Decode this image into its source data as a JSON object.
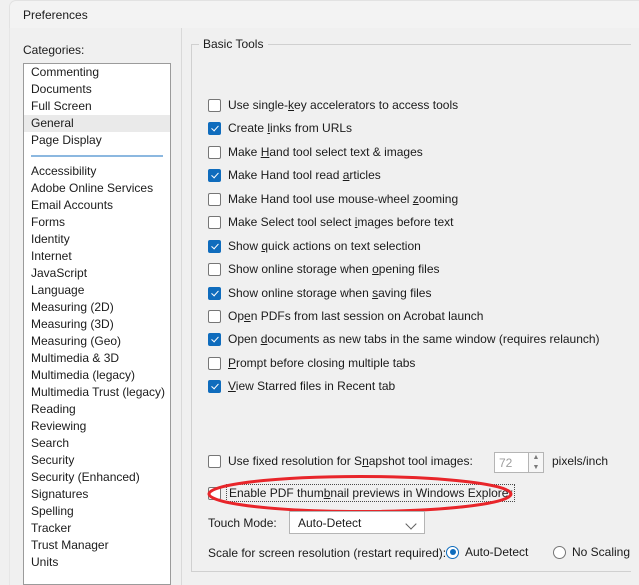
{
  "window": {
    "title": "Preferences"
  },
  "categories": {
    "label": "Categories:",
    "selected": "General",
    "group_top": [
      "Commenting",
      "Documents",
      "Full Screen",
      "General",
      "Page Display"
    ],
    "group_bottom": [
      "Accessibility",
      "Adobe Online Services",
      "Email Accounts",
      "Forms",
      "Identity",
      "Internet",
      "JavaScript",
      "Language",
      "Measuring (2D)",
      "Measuring (3D)",
      "Measuring (Geo)",
      "Multimedia & 3D",
      "Multimedia (legacy)",
      "Multimedia Trust (legacy)",
      "Reading",
      "Reviewing",
      "Search",
      "Security",
      "Security (Enhanced)",
      "Signatures",
      "Spelling",
      "Tracker",
      "Trust Manager",
      "Units"
    ]
  },
  "basic_tools": {
    "title": "Basic Tools",
    "checkboxes": [
      {
        "label": "Use single-key accelerators to access tools",
        "pre": "Use single-",
        "accel": "k",
        "post": "ey accelerators to access tools",
        "checked": false
      },
      {
        "label": "Create links from URLs",
        "pre": "Create ",
        "accel": "l",
        "post": "inks from URLs",
        "checked": true
      },
      {
        "label": "Make Hand tool select text & images",
        "pre": "Make ",
        "accel": "H",
        "post": "and tool select text & images",
        "checked": false
      },
      {
        "label": "Make Hand tool read articles",
        "pre": "Make Hand tool read ",
        "accel": "a",
        "post": "rticles",
        "checked": true
      },
      {
        "label": "Make Hand tool use mouse-wheel zooming",
        "pre": "Make Hand tool use mouse-wheel ",
        "accel": "z",
        "post": "ooming",
        "checked": false
      },
      {
        "label": "Make Select tool select images before text",
        "pre": "Make Select tool select ",
        "accel": "i",
        "post": "mages before text",
        "checked": false
      },
      {
        "label": "Show quick actions on text selection",
        "pre": "Show ",
        "accel": "q",
        "post": "uick actions on text selection",
        "checked": true
      },
      {
        "label": "Show online storage when opening files",
        "pre": "Show online storage when ",
        "accel": "o",
        "post": "pening files",
        "checked": false
      },
      {
        "label": "Show online storage when saving files",
        "pre": "Show online storage when ",
        "accel": "s",
        "post": "aving files",
        "checked": true
      },
      {
        "label": "Open PDFs from last session on Acrobat launch",
        "pre": "Op",
        "accel": "e",
        "post": "n PDFs from last session on Acrobat launch",
        "checked": false
      },
      {
        "label": "Open documents as new tabs in the same window (requires relaunch)",
        "pre": "Open ",
        "accel": "d",
        "post": "ocuments as new tabs in the same window (requires relaunch)",
        "checked": true
      },
      {
        "label": "Prompt before closing multiple tabs",
        "pre": "",
        "accel": "P",
        "post": "rompt before closing multiple tabs",
        "checked": false
      },
      {
        "label": "View Starred files in Recent tab",
        "pre": "",
        "accel": "V",
        "post": "iew Starred files in Recent tab",
        "checked": true
      }
    ],
    "snapshot": {
      "label": "Use fixed resolution for Snapshot tool images:",
      "pre": "Use fixed resolution for S",
      "accel": "n",
      "post": "apshot tool images:",
      "checked": false,
      "value": "72",
      "unit": "pixels/inch",
      "spin_up_icon": "spinner-up-arrow",
      "spin_down_icon": "spinner-down-arrow"
    },
    "thumbnail": {
      "label": "Enable PDF thumbnail previews in Windows Explorer",
      "pre": "Enable PDF thum",
      "accel": "b",
      "post": "nail previews in Windows Explorer",
      "checked": false,
      "focused": true,
      "annotation_color": "#e8252a"
    },
    "touch_mode": {
      "label": "Touch Mode:",
      "value": "Auto-Detect",
      "chevron_icon": "chevron-down-icon"
    },
    "scale": {
      "label": "Scale for screen resolution (restart required):",
      "options": [
        {
          "label": "Auto-Detect",
          "selected": true
        },
        {
          "label": "No Scaling",
          "selected": false
        }
      ]
    }
  },
  "colors": {
    "accent": "#0f6cbd",
    "annotation": "#e8252a",
    "separator": "#8cb8e0",
    "selection": "#eaeaea"
  }
}
